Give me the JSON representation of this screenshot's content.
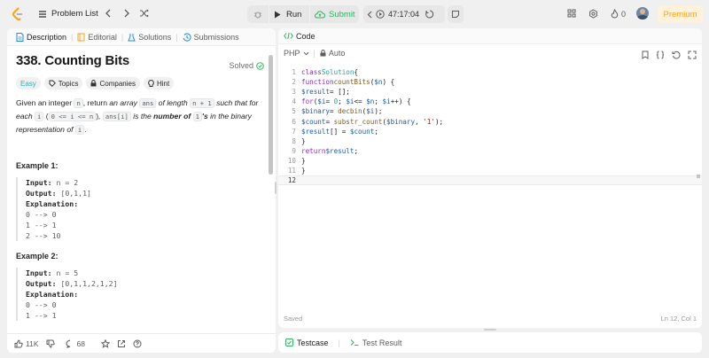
{
  "topbar": {
    "problem_list": "Problem List",
    "run": "Run",
    "submit": "Submit",
    "timer": "47:17:04",
    "streak": "0",
    "premium": "Premium"
  },
  "left": {
    "tabs": [
      "Description",
      "Editorial",
      "Solutions",
      "Submissions"
    ],
    "title": "338. Counting Bits",
    "solved": "Solved",
    "tags": [
      "Easy",
      "Topics",
      "Companies",
      "Hint"
    ],
    "likes": "11K",
    "comments": "68",
    "ex1_title": "Example 1:",
    "ex2_title": "Example 2:"
  },
  "code": {
    "tab": "Code",
    "language": "PHP",
    "mode": "Auto",
    "saved": "Saved",
    "position": "Ln 12, Col 1"
  },
  "bottom": {
    "testcase": "Testcase",
    "test_result": "Test Result"
  },
  "colors": {
    "submit_green": "#2db55d",
    "premium": "#ffa116",
    "easy": "#1cb8b8"
  }
}
